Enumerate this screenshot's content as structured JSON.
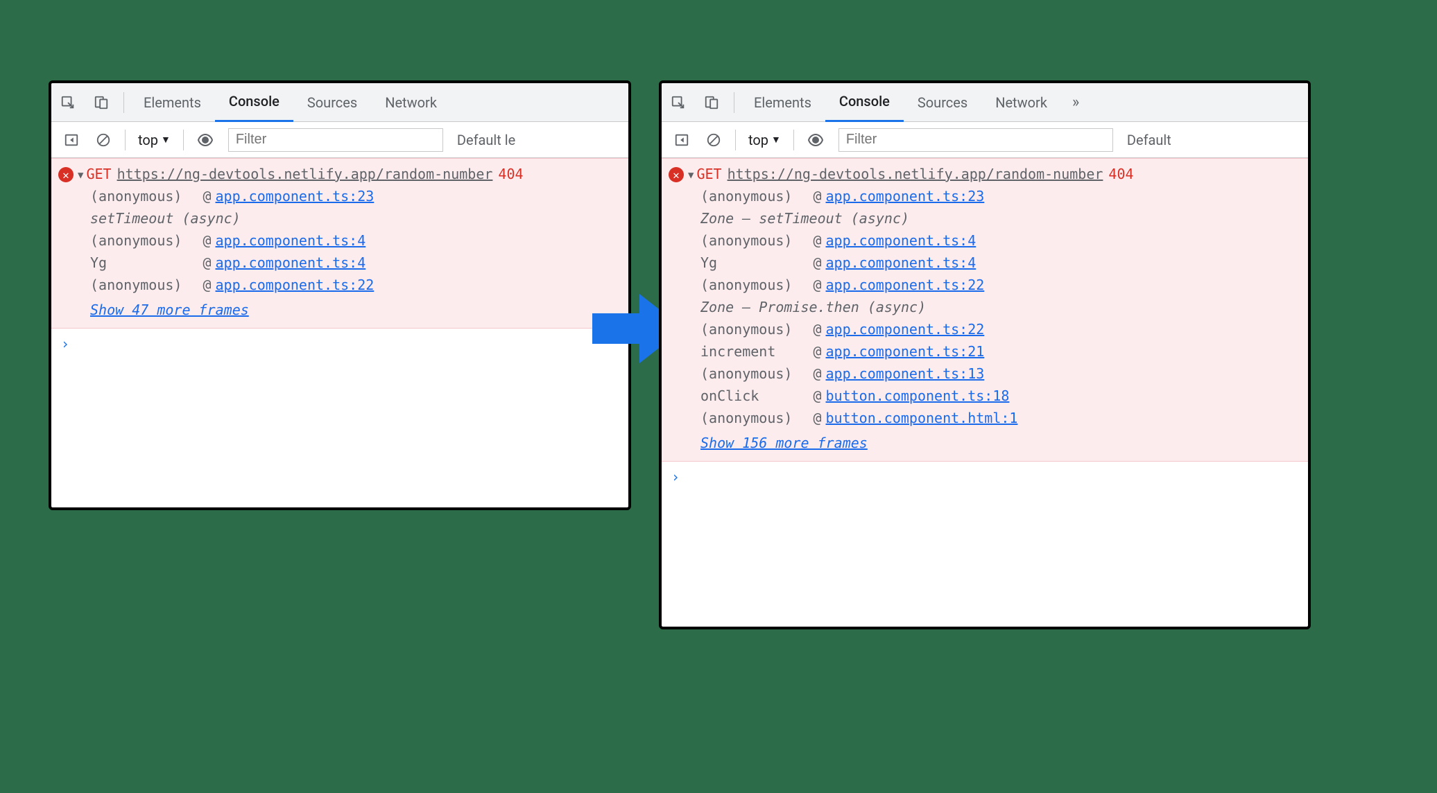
{
  "tabs": {
    "elements": "Elements",
    "console": "Console",
    "sources": "Sources",
    "network": "Network"
  },
  "overflow": "»",
  "subbar": {
    "context": "top",
    "filter_placeholder": "Filter",
    "levels_left": "Default le",
    "levels_right": "Default"
  },
  "left": {
    "method": "GET",
    "url": "https://ng-devtools.netlify.app/random-number",
    "status": "404",
    "stack": [
      {
        "fn": "(anonymous)",
        "src": "app.component.ts:23"
      },
      {
        "fn": "setTimeout (async)",
        "italic": true
      },
      {
        "fn": "(anonymous)",
        "src": "app.component.ts:4"
      },
      {
        "fn": "Yg",
        "src": "app.component.ts:4"
      },
      {
        "fn": "(anonymous)",
        "src": "app.component.ts:22"
      }
    ],
    "show_more": "Show 47 more frames"
  },
  "right": {
    "method": "GET",
    "url": "https://ng-devtools.netlify.app/random-number",
    "status": "404",
    "stack": [
      {
        "fn": "(anonymous)",
        "src": "app.component.ts:23"
      },
      {
        "fn": "Zone – setTimeout (async)",
        "italic": true
      },
      {
        "fn": "(anonymous)",
        "src": "app.component.ts:4"
      },
      {
        "fn": "Yg",
        "src": "app.component.ts:4"
      },
      {
        "fn": "(anonymous)",
        "src": "app.component.ts:22"
      },
      {
        "fn": "Zone – Promise.then (async)",
        "italic": true
      },
      {
        "fn": "(anonymous)",
        "src": "app.component.ts:22"
      },
      {
        "fn": "increment",
        "src": "app.component.ts:21"
      },
      {
        "fn": "(anonymous)",
        "src": "app.component.ts:13"
      },
      {
        "fn": "onClick",
        "src": "button.component.ts:18"
      },
      {
        "fn": "(anonymous)",
        "src": "button.component.html:1"
      }
    ],
    "show_more": "Show 156 more frames"
  },
  "prompt": "›",
  "at_symbol": "@"
}
